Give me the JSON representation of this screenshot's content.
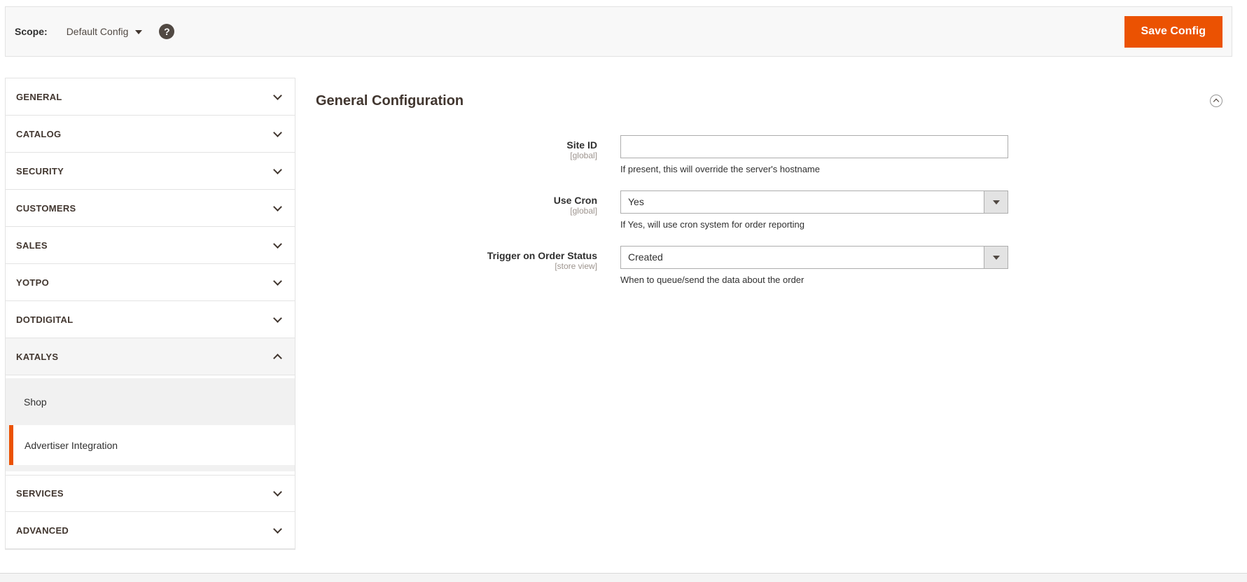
{
  "header": {
    "scope_label": "Scope:",
    "scope_value": "Default Config",
    "help_icon_glyph": "?",
    "save_button": "Save Config"
  },
  "sidebar": {
    "sections": [
      {
        "label": "GENERAL",
        "state": "collapsed"
      },
      {
        "label": "CATALOG",
        "state": "collapsed"
      },
      {
        "label": "SECURITY",
        "state": "collapsed"
      },
      {
        "label": "CUSTOMERS",
        "state": "collapsed"
      },
      {
        "label": "SALES",
        "state": "collapsed"
      },
      {
        "label": "YOTPO",
        "state": "collapsed"
      },
      {
        "label": "DOTDIGITAL",
        "state": "collapsed"
      },
      {
        "label": "KATALYS",
        "state": "expanded",
        "children": [
          {
            "label": "Shop",
            "active": false
          },
          {
            "label": "Advertiser Integration",
            "active": true
          }
        ]
      },
      {
        "label": "SERVICES",
        "state": "collapsed"
      },
      {
        "label": "ADVANCED",
        "state": "collapsed"
      }
    ]
  },
  "main": {
    "section_title": "General Configuration",
    "fields": [
      {
        "label": "Site ID",
        "scope": "[global]",
        "type": "text",
        "value": "",
        "note": "If present, this will override the server's hostname"
      },
      {
        "label": "Use Cron",
        "scope": "[global]",
        "type": "select",
        "value": "Yes",
        "note": "If Yes, will use cron system for order reporting"
      },
      {
        "label": "Trigger on Order Status",
        "scope": "[store view]",
        "type": "select",
        "value": "Created",
        "note": "When to queue/send the data about the order"
      }
    ]
  },
  "colors": {
    "accent_orange": "#eb5202",
    "bar_background": "#f8f8f8",
    "border": "#e3e3e3",
    "input_border": "#adadad",
    "heading_text": "#41362f"
  }
}
